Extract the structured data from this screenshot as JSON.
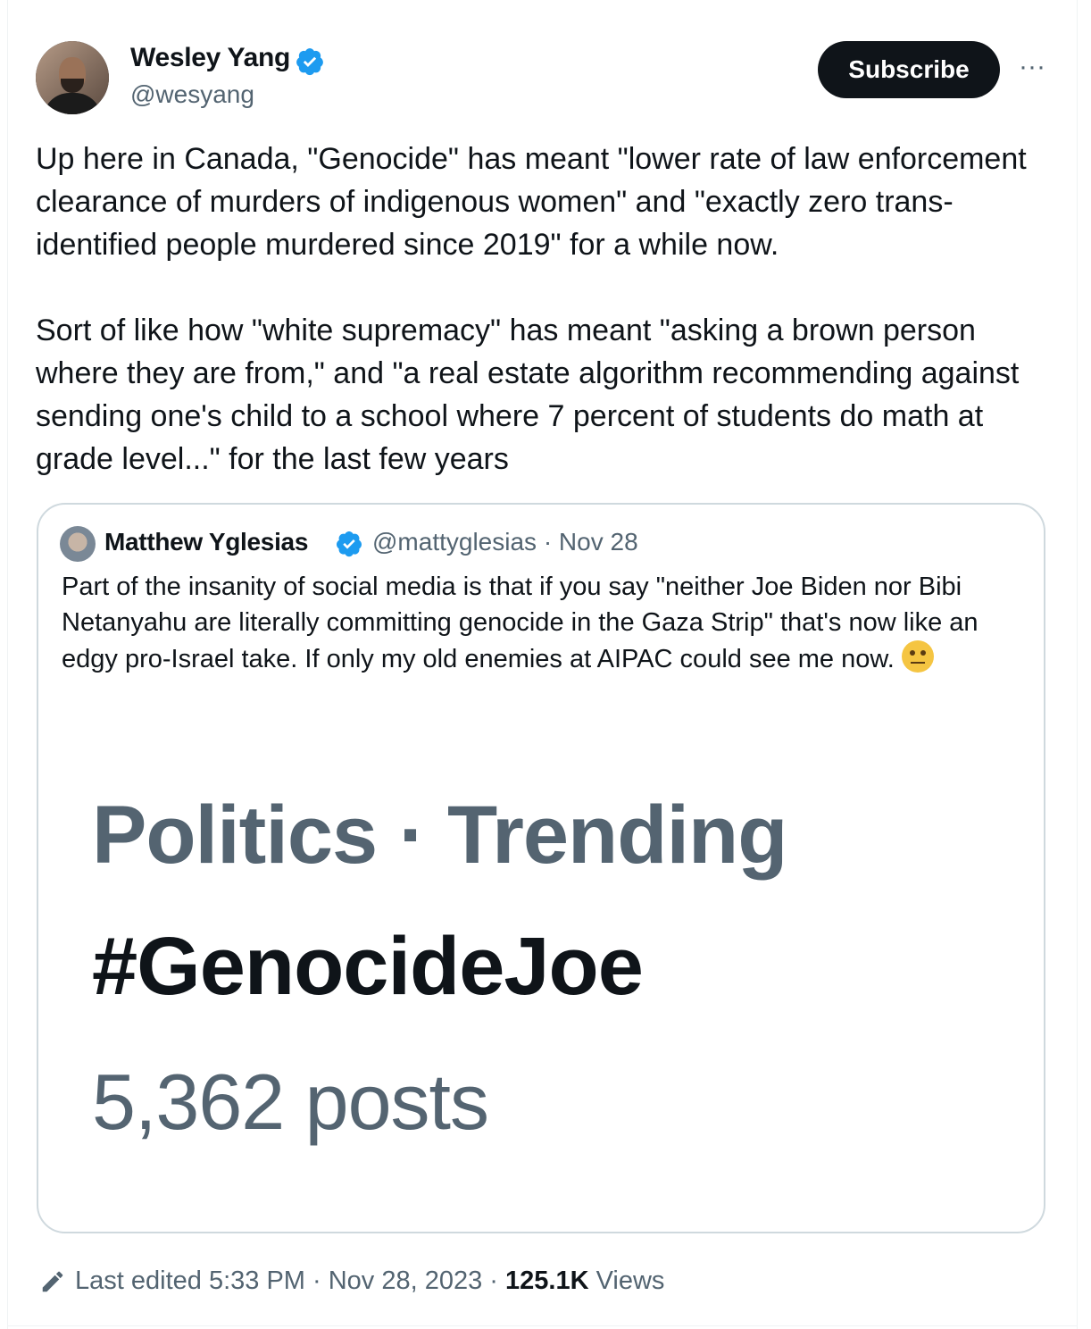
{
  "author": {
    "name": "Wesley Yang",
    "handle": "@wesyang"
  },
  "actions": {
    "subscribe_label": "Subscribe",
    "more_label": "···"
  },
  "tweet": {
    "text": "Up here in Canada, \"Genocide\" has meant \"lower rate of law enforcement clearance of murders of indigenous women\" and \"exactly zero trans-identified people murdered since 2019\" for a while now.\n\nSort of like how \"white supremacy\" has meant \"asking a brown person where they are from,\" and \"a real estate algorithm recommending against sending one's child to a school where 7 percent of students do math at grade level...\" for the last few years"
  },
  "quote": {
    "name": "Matthew Yglesias",
    "meta": "@mattyglesias · Nov 28",
    "text": "Part of the insanity of social media is that if you say \"neither Joe Biden nor Bibi Netanyahu are literally committing genocide in the Gaza Strip\" that's now like an edgy pro-Israel take. If only my old enemies at AIPAC could see me now.",
    "emoji": "face-with-rolling-eyes",
    "image": {
      "line1": "Politics · Trending",
      "line2": "#GenocideJoe",
      "line3": "5,362 posts"
    }
  },
  "footer": {
    "edited": "Last edited 5:33 PM · Nov 28, 2023 · ",
    "views_count": "125.1K",
    "views_label": " Views"
  },
  "colors": {
    "primary_text": "#0f1419",
    "secondary_text": "#536471",
    "verified_blue": "#1d9bf0",
    "border": "#cfd9de"
  }
}
